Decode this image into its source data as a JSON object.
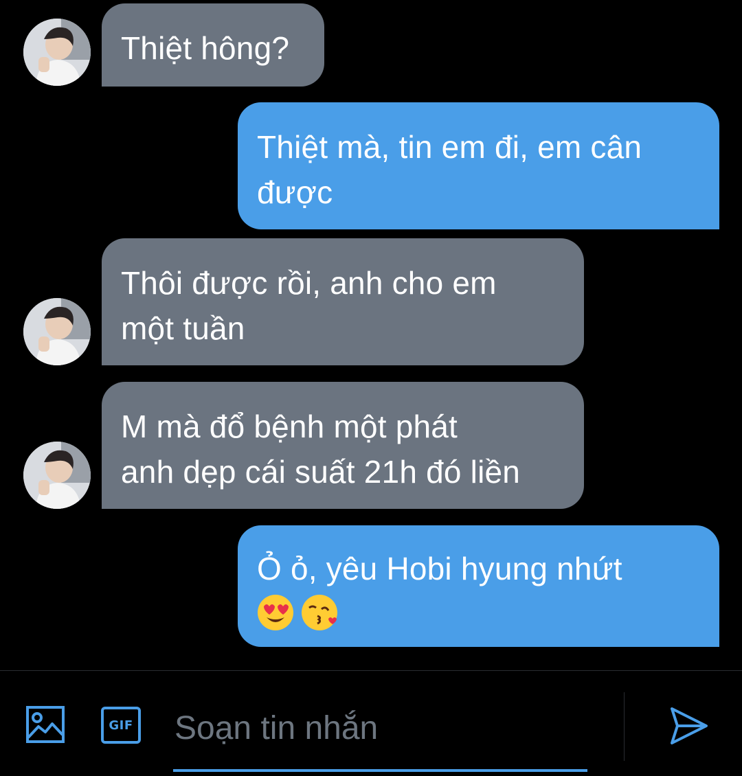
{
  "messages": [
    {
      "direction": "incoming",
      "lines": [
        "Thiệt hông?"
      ]
    },
    {
      "direction": "outgoing",
      "lines": [
        "Thiệt mà, tin em đi, em cân",
        "được"
      ]
    },
    {
      "direction": "incoming",
      "lines": [
        "Thôi được rồi, anh cho em",
        "một tuần"
      ]
    },
    {
      "direction": "incoming",
      "lines": [
        "M mà đổ bệnh một phát",
        "anh dẹp cái suất 21h đó liền"
      ]
    },
    {
      "direction": "outgoing",
      "lines": [
        "Ỏ ỏ, yêu Hobi hyung nhứt"
      ],
      "emojis": [
        "heart-eyes-emoji",
        "kissing-heart-emoji"
      ]
    }
  ],
  "composer": {
    "placeholder": "Soạn tin nhắn",
    "gif_label": "GIF",
    "image_icon": "image-icon",
    "send_icon": "send-icon"
  },
  "colors": {
    "background": "#000000",
    "incoming_bubble": "#6b7480",
    "outgoing_bubble": "#4a9ee8",
    "accent": "#4a9ee8",
    "placeholder": "#6d7680"
  }
}
